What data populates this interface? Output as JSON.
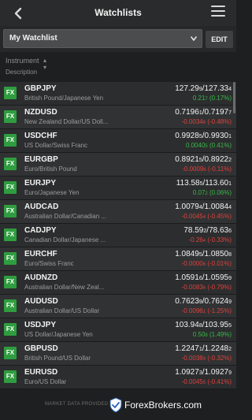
{
  "header": {
    "title": "Watchlists",
    "back_icon": "chevron-left-icon",
    "menu_icon": "hamburger-menu-icon"
  },
  "watchlist": {
    "selected": "My Watchlist",
    "edit_label": "EDIT"
  },
  "columns": {
    "instrument": "Instrument",
    "description": "Description",
    "sort_icon": "sort-icon"
  },
  "rows": [
    {
      "badge": "FX",
      "symbol": "GBPJPY",
      "name": "British Pound/Japanese Yen",
      "bid": "127.29",
      "bid_small": "9",
      "ask": "127.33",
      "ask_small": "4",
      "change": "0.21",
      "change_small": "7",
      "pct": "(0.17%)",
      "dir": "pos"
    },
    {
      "badge": "FX",
      "symbol": "NZDUSD",
      "name": "New Zealand Dollar/US Doll...",
      "bid": "0.7196",
      "bid_small": "1",
      "ask": "0.7197",
      "ask_small": "7",
      "change": "-0.0034",
      "change_small": "6",
      "pct": "(-0.48%)",
      "dir": "neg"
    },
    {
      "badge": "FX",
      "symbol": "USDCHF",
      "name": "US Dollar/Swiss Franc",
      "bid": "0.9928",
      "bid_small": "5",
      "ask": "0.9930",
      "ask_small": "1",
      "change": "0.0040",
      "change_small": "5",
      "pct": "(0.41%)",
      "dir": "pos"
    },
    {
      "badge": "FX",
      "symbol": "EURGBP",
      "name": "Euro/British Pound",
      "bid": "0.8921",
      "bid_small": "5",
      "ask": "0.8922",
      "ask_small": "2",
      "change": "-0.0009",
      "change_small": "6",
      "pct": "(-0.11%)",
      "dir": "neg"
    },
    {
      "badge": "FX",
      "symbol": "EURJPY",
      "name": "Euro/Japanese Yen",
      "bid": "113.58",
      "bid_small": "5",
      "ask": "113.60",
      "ask_small": "1",
      "change": "0.07",
      "change_small": "2",
      "pct": "(0.06%)",
      "dir": "pos"
    },
    {
      "badge": "FX",
      "symbol": "AUDCAD",
      "name": "Australian Dollar/Canadian ...",
      "bid": "1.0079",
      "bid_small": "4",
      "ask": "1.0084",
      "ask_small": "4",
      "change": "-0.0045",
      "change_small": "4",
      "pct": "(-0.45%)",
      "dir": "neg"
    },
    {
      "badge": "FX",
      "symbol": "CADJPY",
      "name": "Canadian Dollar/Japanese ...",
      "bid": "78.59",
      "bid_small": "2",
      "ask": "78.63",
      "ask_small": "6",
      "change": "-0.26",
      "change_small": "4",
      "pct": "(-0.33%)",
      "dir": "neg"
    },
    {
      "badge": "FX",
      "symbol": "EURCHF",
      "name": "Euro/Swiss Franc",
      "bid": "1.0849",
      "bid_small": "5",
      "ask": "1.0850",
      "ask_small": "8",
      "change": "-0.0000",
      "change_small": "6",
      "pct": "(-0.01%)",
      "dir": "neg"
    },
    {
      "badge": "FX",
      "symbol": "AUDNZD",
      "name": "Australian Dollar/New Zeal...",
      "bid": "1.0591",
      "bid_small": "6",
      "ask": "1.0595",
      "ask_small": "9",
      "change": "-0.0083",
      "change_small": "6",
      "pct": "(-0.79%)",
      "dir": "neg"
    },
    {
      "badge": "FX",
      "symbol": "AUDUSD",
      "name": "Australian Dollar/US Dollar",
      "bid": "0.7623",
      "bid_small": "9",
      "ask": "0.7624",
      "ask_small": "9",
      "change": "-0.0096",
      "change_small": "1",
      "pct": "(-1.25%)",
      "dir": "neg"
    },
    {
      "badge": "FX",
      "symbol": "USDJPY",
      "name": "US Dollar/Japanese Yen",
      "bid": "103.94",
      "bid_small": "8",
      "ask": "103.95",
      "ask_small": "5",
      "change": "0.50",
      "change_small": "8",
      "pct": "(1.49%)",
      "dir": "pos"
    },
    {
      "badge": "FX",
      "symbol": "GBPUSD",
      "name": "British Pound/US Dollar",
      "bid": "1.2247",
      "bid_small": "1",
      "ask": "1.2248",
      "ask_small": "2",
      "change": "-0.0038",
      "change_small": "9",
      "pct": "(-0.32%)",
      "dir": "neg"
    },
    {
      "badge": "FX",
      "symbol": "EURUSD",
      "name": "Euro/US Dollar",
      "bid": "1.0927",
      "bid_small": "3",
      "ask": "1.0927",
      "ask_small": "9",
      "change": "-0.0045",
      "change_small": "5",
      "pct": "(-0.41%)",
      "dir": "neg"
    }
  ],
  "footer": {
    "provided": "MARKET DATA PROVIDED",
    "brand": "ForexBrokers.com",
    "logo_icon": "shield-logo-icon"
  },
  "colors": {
    "positive": "#38b94a",
    "negative": "#e0413e",
    "badge": "#2f9d3f"
  }
}
